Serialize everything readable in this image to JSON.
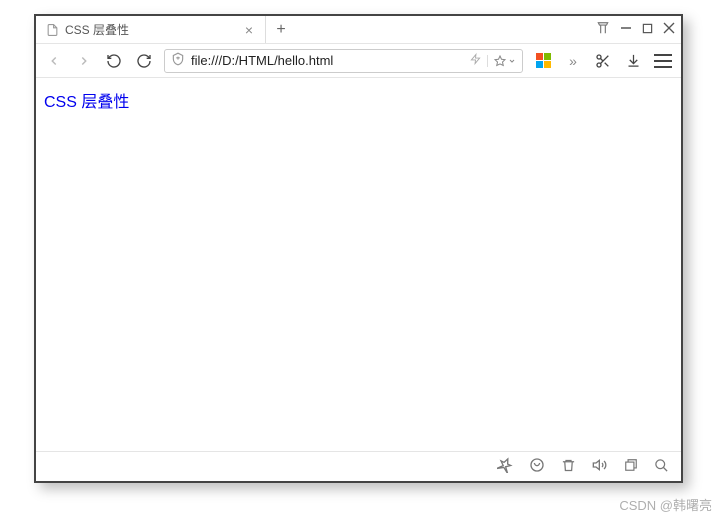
{
  "tab": {
    "title": "CSS 层叠性"
  },
  "url": "file:///D:/HTML/hello.html",
  "page": {
    "heading": "CSS 层叠性"
  },
  "watermark": "CSDN @韩曙亮"
}
